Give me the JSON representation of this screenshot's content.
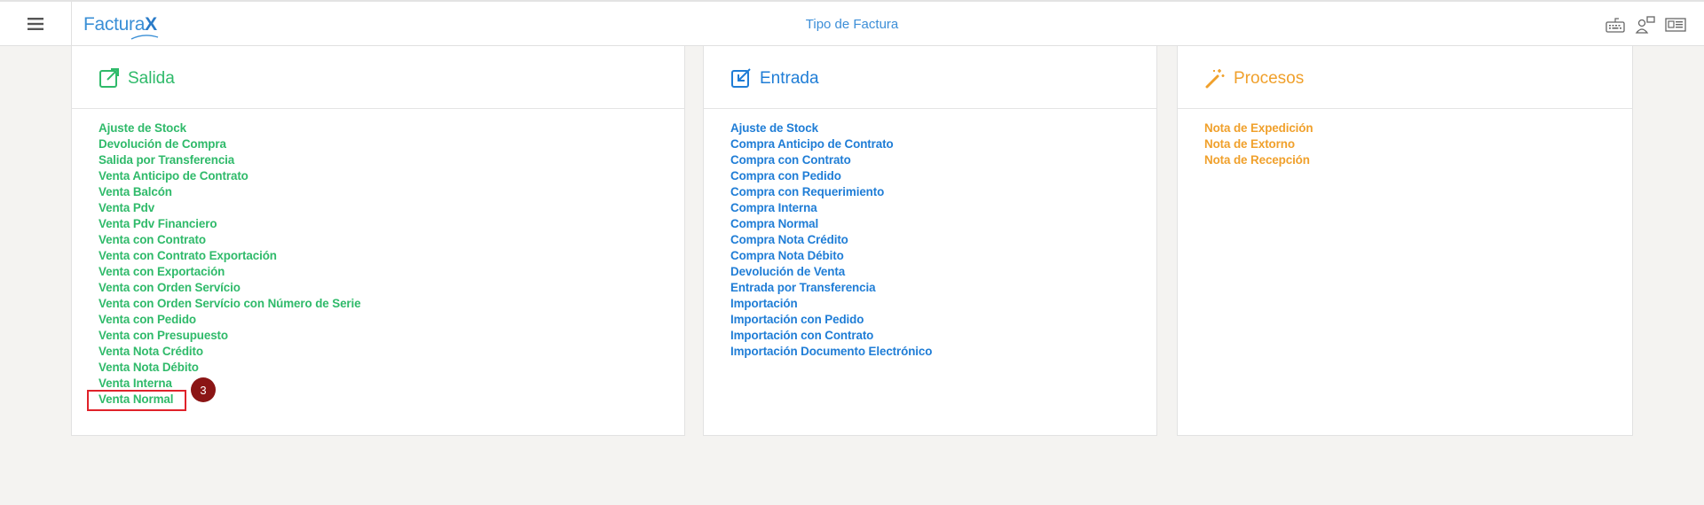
{
  "header": {
    "logo_text": "Factura",
    "logo_x": "X",
    "title": "Tipo de Factura",
    "icons": [
      "hamburger-menu-icon",
      "keyboard-icon",
      "users-icon",
      "id-card-icon"
    ]
  },
  "colors": {
    "salida": "#2fba6a",
    "entrada": "#1f7dd6",
    "procesos": "#f0a02b",
    "highlight": "#e0222a",
    "badge": "#8b1515"
  },
  "salida": {
    "title": "Salida",
    "icon": "external-link-icon",
    "items": [
      "Ajuste de Stock",
      "Devolución de Compra",
      "Salida por Transferencia",
      "Venta Anticipo de Contrato",
      "Venta Balcón",
      "Venta Pdv",
      "Venta Pdv Financiero",
      "Venta con Contrato",
      "Venta con Contrato Exportación",
      "Venta con Exportación",
      "Venta con Orden Servício",
      "Venta con Orden Servício con Número de Serie",
      "Venta con Pedido",
      "Venta con Presupuesto",
      "Venta Nota Crédito",
      "Venta Nota Débito",
      "Venta Interna",
      "Venta Normal"
    ]
  },
  "entrada": {
    "title": "Entrada",
    "icon": "edit-box-icon",
    "items": [
      "Ajuste de Stock",
      "Compra Anticipo de Contrato",
      "Compra con Contrato",
      "Compra con Pedido",
      "Compra con Requerimiento",
      "Compra Interna",
      "Compra Normal",
      "Compra Nota Crédito",
      "Compra Nota Débito",
      "Devolución de Venta",
      "Entrada por Transferencia",
      "Importación",
      "Importación con Pedido",
      "Importación con Contrato",
      "Importación Documento Electrónico"
    ]
  },
  "procesos": {
    "title": "Procesos",
    "icon": "magic-wand-icon",
    "items": [
      "Nota de Expedición",
      "Nota de Extorno",
      "Nota de Recepción"
    ]
  },
  "annotation": {
    "step_number": "3"
  }
}
